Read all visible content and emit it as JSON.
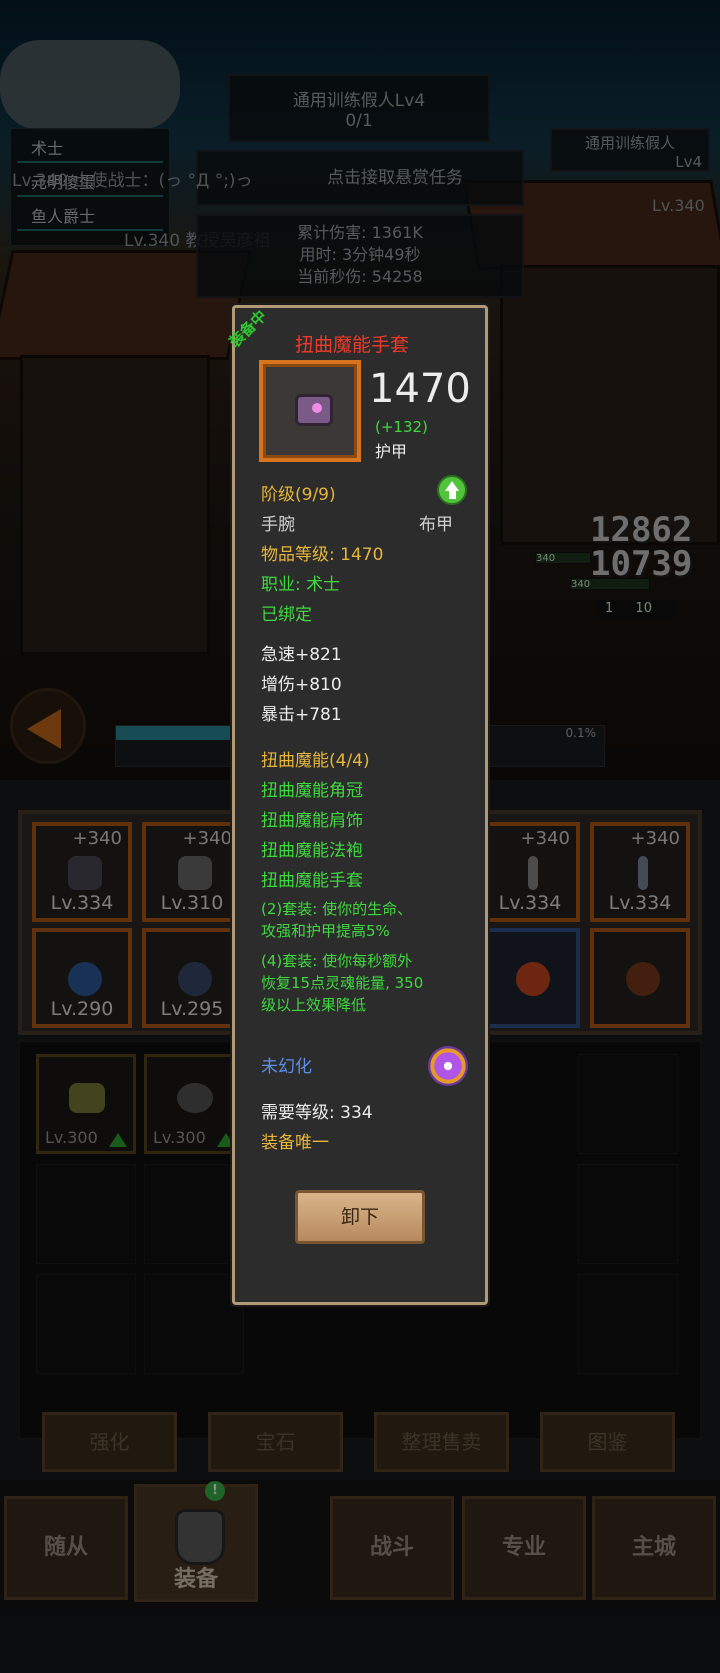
{
  "scene": {
    "quest_title": "通用训练假人Lv4",
    "quest_progress": "0/1",
    "right_quest_title": "通用训练假人",
    "right_quest_level": "Lv4",
    "bounty_button": "点击接取悬赏任务",
    "team": [
      "术士",
      "元明傻蛋",
      "鱼人爵士"
    ],
    "chat_line_1": "Lv.340 士使战士：(っ °Д °;)っ",
    "chat_line_2": "Lv.340 教授吴彦祖",
    "right_level": "Lv.340",
    "stats": {
      "total_damage": "累计伤害: 1361K",
      "time_used": "用时: 3分钟49秒",
      "current_dps": "当前秒伤: 54258"
    },
    "damage_numbers": [
      "12862",
      "10739"
    ],
    "mini_labels": [
      "340",
      "340",
      "1",
      "10"
    ],
    "progress_pct": "0.1%"
  },
  "equipment_slots": [
    {
      "plus": "+340",
      "level": "Lv.334",
      "border": "orange",
      "icon": "shoulder-icon"
    },
    {
      "plus": "+340",
      "level": "Lv.310",
      "border": "orange",
      "icon": "robe-icon"
    },
    {
      "plus": "+340",
      "level": "Lv.334",
      "border": "orange",
      "icon": "staff-icon"
    },
    {
      "plus": "+340",
      "level": "Lv.334",
      "border": "orange",
      "icon": "wand-icon"
    },
    {
      "plus": "",
      "level": "Lv.290",
      "border": "orange",
      "icon": "bracer-icon"
    },
    {
      "plus": "",
      "level": "Lv.295",
      "border": "orange",
      "icon": "ring-icon"
    },
    {
      "plus": "",
      "level": "",
      "border": "blue",
      "icon": "orb-icon"
    },
    {
      "plus": "",
      "level": "",
      "border": "orange",
      "icon": "trinket-icon"
    }
  ],
  "bag_items": [
    {
      "level": "Lv.300",
      "upgrade": true,
      "icon": "boot-icon"
    },
    {
      "level": "Lv.300",
      "upgrade": true,
      "icon": "helm-icon"
    }
  ],
  "actions": [
    "强化",
    "宝石",
    "整理售卖",
    "图鉴"
  ],
  "nav": [
    "随从",
    "装备",
    "战斗",
    "专业",
    "主城"
  ],
  "nav_badge": "!",
  "tooltip": {
    "equipped_badge": "装备中",
    "item_name": "扭曲魔能手套",
    "stat_value": "1470",
    "stat_bonus": "(+132)",
    "stat_name": "护甲",
    "tier": "阶级(9/9)",
    "slot": "手腕",
    "armor_type": "布甲",
    "item_level": "物品等级: 1470",
    "class": "职业: 术士",
    "bound": "已绑定",
    "attributes": [
      "急速+821",
      "增伤+810",
      "暴击+781"
    ],
    "set_name": "扭曲魔能(4/4)",
    "set_pieces": [
      "扭曲魔能角冠",
      "扭曲魔能肩饰",
      "扭曲魔能法袍",
      "扭曲魔能手套"
    ],
    "set_bonus_2": [
      "(2)套装: 使你的生命、",
      "攻强和护甲提高5%"
    ],
    "set_bonus_4": [
      "(4)套装: 使你每秒额外",
      "恢复15点灵魂能量, 350",
      "级以上效果降低"
    ],
    "illusion": "未幻化",
    "required_level": "需要等级: 334",
    "unique": "装备唯一",
    "unequip_button": "卸下"
  },
  "colors": {
    "gold": "#e7b53c",
    "green": "#3fd93f",
    "item_name_red": "#ee3a2a",
    "illusion_blue": "#5e8ee8",
    "tooltip_border": "#b39a77"
  }
}
